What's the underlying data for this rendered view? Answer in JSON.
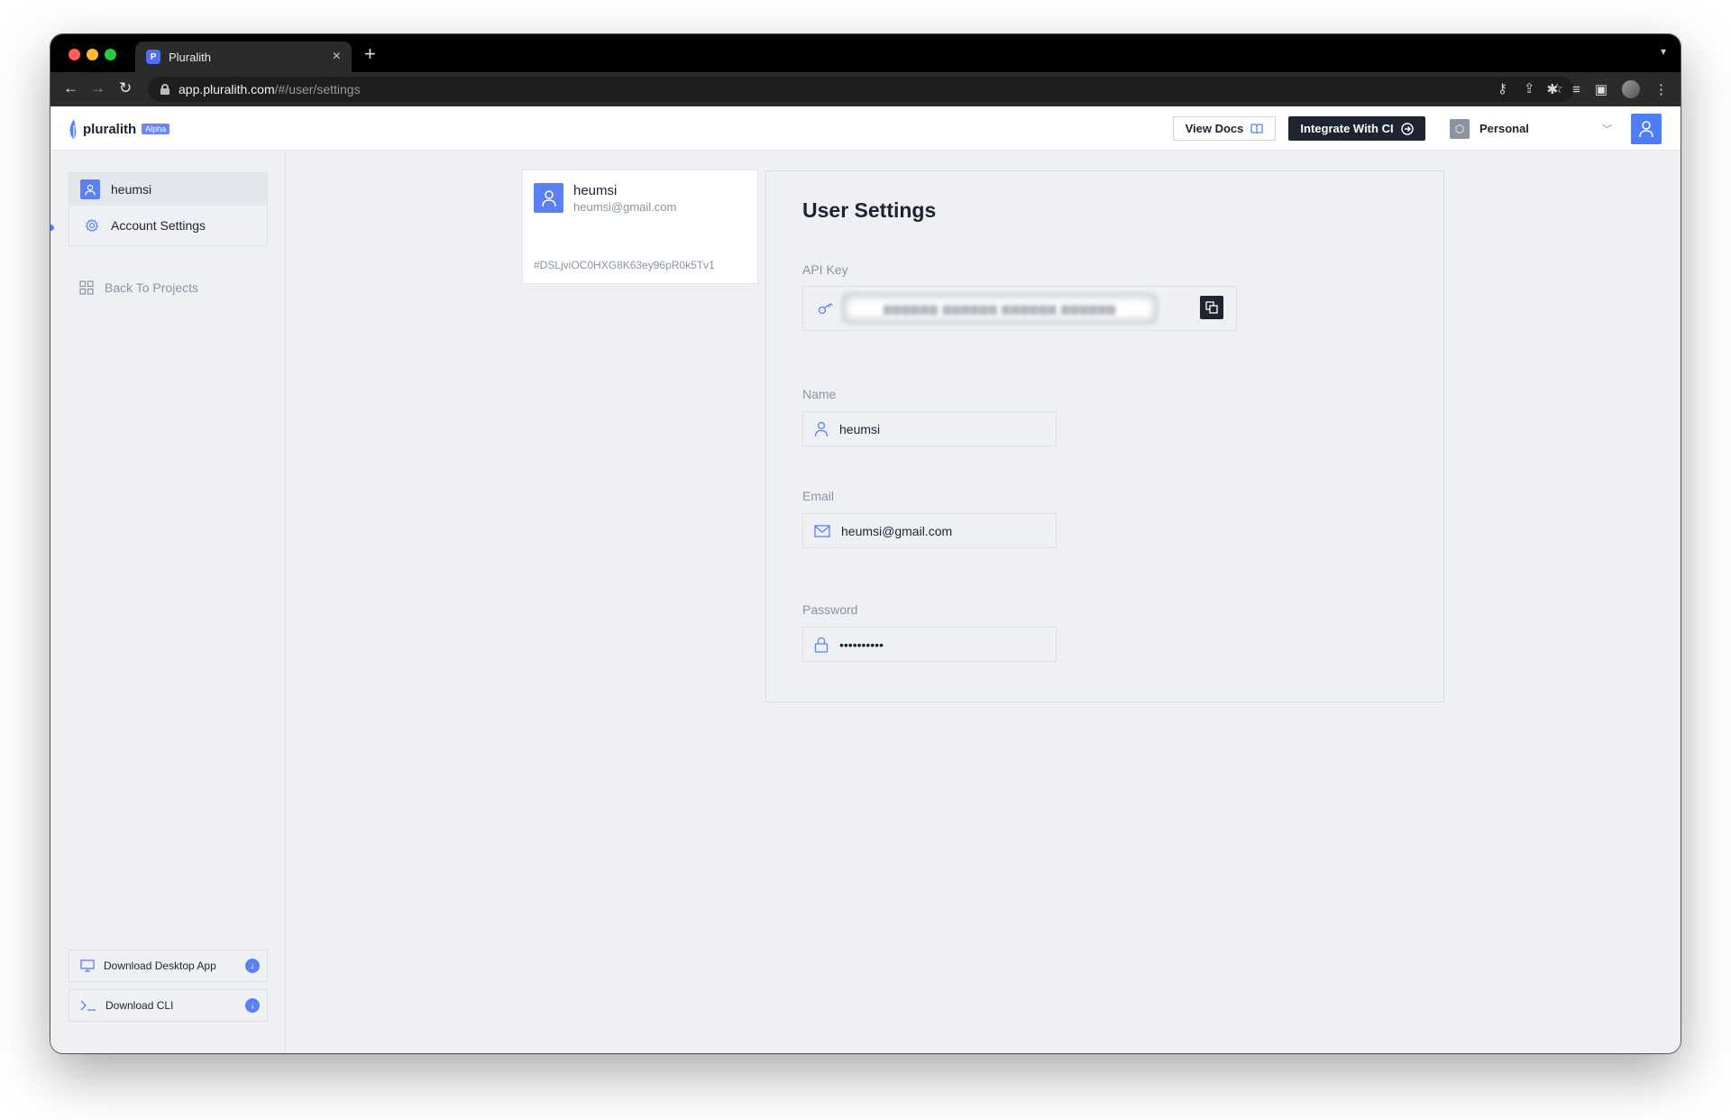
{
  "browser": {
    "tab_title": "Pluralith",
    "tab_favicon": "P",
    "url_host": "app.pluralith.com",
    "url_path": "/#/user/settings"
  },
  "header": {
    "logo_text": "pluralith",
    "logo_badge": "Alpha",
    "view_docs_label": "View Docs",
    "integrate_label": "Integrate With CI",
    "org_label": "Personal"
  },
  "sidebar": {
    "user_name": "heumsi",
    "account_settings_label": "Account Settings",
    "back_to_projects_label": "Back To Projects",
    "download_desktop_label": "Download Desktop App",
    "download_cli_label": "Download CLI"
  },
  "profile": {
    "name": "heumsi",
    "email": "heumsi@gmail.com",
    "user_id": "#DSLjviOC0HXG8K63ey96pR0k5Tv1"
  },
  "settings": {
    "title": "User Settings",
    "api_key_label": "API Key",
    "name_label": "Name",
    "name_value": "heumsi",
    "email_label": "Email",
    "email_value": "heumsi@gmail.com",
    "password_label": "Password",
    "password_value": "••••••••••"
  },
  "colors": {
    "accent": "#5b80f5",
    "dark_button": "#1e2531",
    "background": "#eef0f4"
  }
}
